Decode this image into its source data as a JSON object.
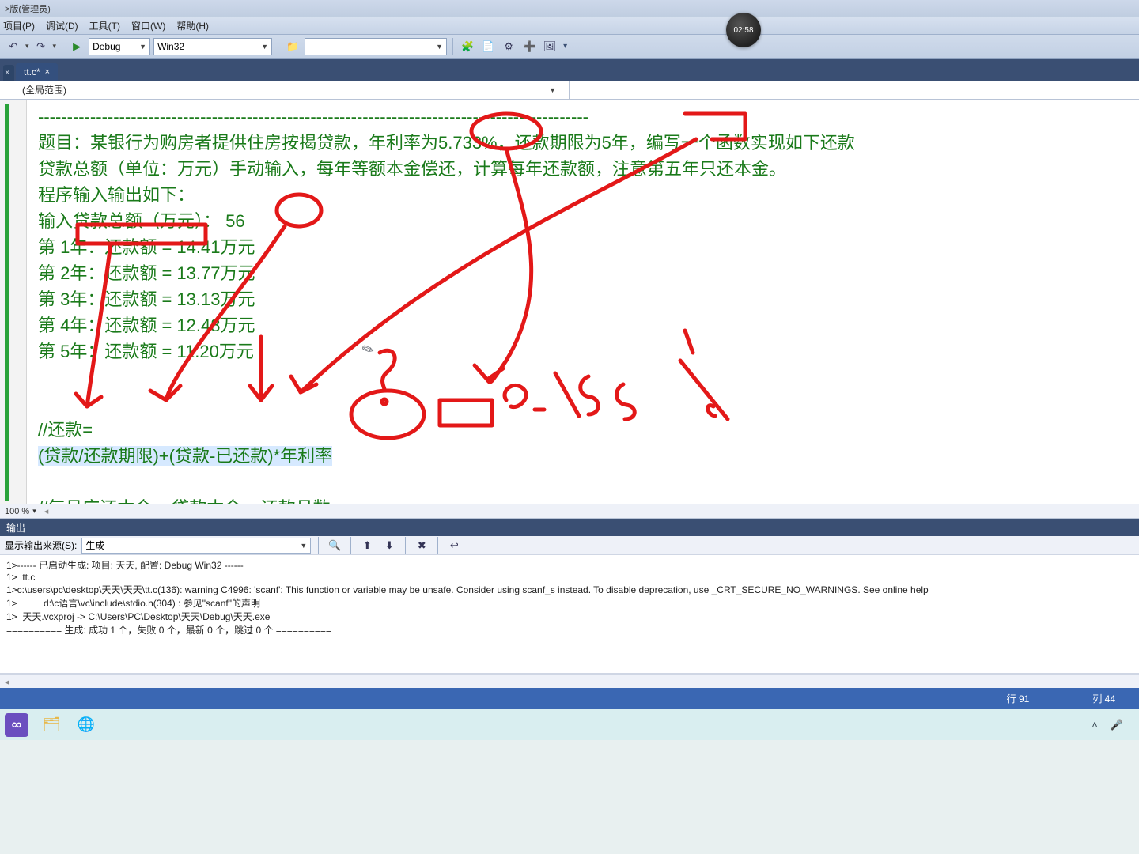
{
  "window": {
    "title": ">版(管理员)"
  },
  "rec_badge": "02:58",
  "menu": {
    "project": "项目(P)",
    "debug": "调试(D)",
    "tools": "工具(T)",
    "window": "窗口(W)",
    "help": "帮助(H)"
  },
  "toolbar": {
    "config": "Debug",
    "platform": "Win32",
    "search": ""
  },
  "tabs": {
    "t0": "",
    "t1": "tt.c*"
  },
  "scope": {
    "combo": "(全局范围)"
  },
  "code": {
    "dash": "-----------------------------------------------------------------------------------------------",
    "l1": "题目：某银行为购房者提供住房按揭贷款，年利率为5.733%，还款期限为5年，编写一个函数实现如下还款",
    "l2": "贷款总额（单位：万元）手动输入，每年等额本金偿还，计算每年还款额，注意第五年只还本金。",
    "l3": "程序输入输出如下：",
    "l4": "输入贷款总额（万元）： 56",
    "l5": "第 1年：还款额 = 14.41万元",
    "l6": "第 2年：还款额 = 13.77万元",
    "l7": "第 3年：还款额 = 13.13万元",
    "l8": "第 4年：还款额 = 12.48万元",
    "l9": "第 5年：还款额 = 11.20万元",
    "l10": "",
    "l11": "",
    "l12_a": "//还款=",
    "l12_b": "(贷款/还款期限)+(贷款-已还款)*年利率",
    "l13": "",
    "l14": "//每月应还本金 = 贷款本金 ÷ 还款月数。"
  },
  "zoom": "100 %",
  "output": {
    "title": "输出",
    "from_label": "显示输出来源(S):",
    "from_value": "生成",
    "lines": {
      "o1": "1>------ 已启动生成: 项目: 天天, 配置: Debug Win32 ------",
      "o2": "1>  tt.c",
      "o3": "1>c:\\users\\pc\\desktop\\天天\\天天\\tt.c(136): warning C4996: 'scanf': This function or variable may be unsafe. Consider using scanf_s instead. To disable deprecation, use _CRT_SECURE_NO_WARNINGS. See online help",
      "o4": "1>          d:\\c语言\\vc\\include\\stdio.h(304) : 参见\"scanf\"的声明",
      "o5": "1>  天天.vcxproj -> C:\\Users\\PC\\Desktop\\天天\\Debug\\天天.exe",
      "o6": "========== 生成: 成功 1 个，失败 0 个，最新 0 个，跳过 0 个 =========="
    }
  },
  "status": {
    "line": "行 91",
    "col": "列 44"
  },
  "icons": {
    "undo": "↶",
    "redo": "↷",
    "play": "▶",
    "folder": "📁",
    "find": "🔍",
    "b1": "🧩",
    "b2": "📄",
    "b3": "⚙",
    "b4": "➕",
    "b5": "🖼"
  },
  "tray": {
    "up": "˄",
    "mic": "🎤"
  }
}
